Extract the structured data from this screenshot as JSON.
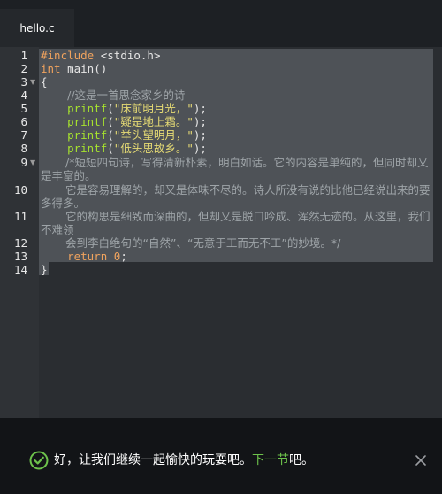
{
  "tab": {
    "filename": "hello.c"
  },
  "editor": {
    "line_numbers": [
      "1",
      "2",
      "3",
      "4",
      "5",
      "6",
      "7",
      "8",
      "9",
      "10",
      "11",
      "12",
      "13",
      "14"
    ],
    "code": {
      "l1_directive": "#include",
      "l1_header": " <stdio.h>",
      "l2_type": "int",
      "l2_rest": " main()",
      "l3": "{",
      "l4_indent": "    ",
      "l4_comment": "//这是一首思念家乡的诗",
      "l5_call": "printf",
      "l5_open": "(",
      "l5_str": "\"床前明月光，\"",
      "l5_close": ");",
      "l6_str": "\"疑是地上霜。\"",
      "l7_str": "\"举头望明月，\"",
      "l8_str": "\"低头思故乡。\"",
      "l9_comment": "/*短短四句诗，写得清新朴素，明白如话。它的内容是单纯的，但同时却又是丰富的。",
      "l10_comment": "它是容易理解的，却又是体味不尽的。诗人所没有说的比他已经说出来的要多得多。",
      "l11_comment": "它的构思是细致而深曲的，但却又是脱口吟成、浑然无迹的。从这里，我们不难领",
      "l12_comment": "会到李白绝句的“自然”、“无意于工而无不工”的妙境。*/",
      "l13_kw": "return",
      "l13_num": "0",
      "l13_end": ";",
      "l14": "}"
    }
  },
  "footer": {
    "message_prefix": "好，让我们继续一起愉快的玩耍吧。",
    "link_text": "下一节",
    "message_suffix": "吧。"
  },
  "colors": {
    "keyword": "#f0a35e",
    "string": "#e6db74",
    "function": "#a6e22e",
    "comment": "#9ea4a8",
    "success": "#6dc24b"
  },
  "icons": {
    "success": "check-circle-icon",
    "close": "close-icon",
    "fold": "fold-arrow-icon"
  }
}
